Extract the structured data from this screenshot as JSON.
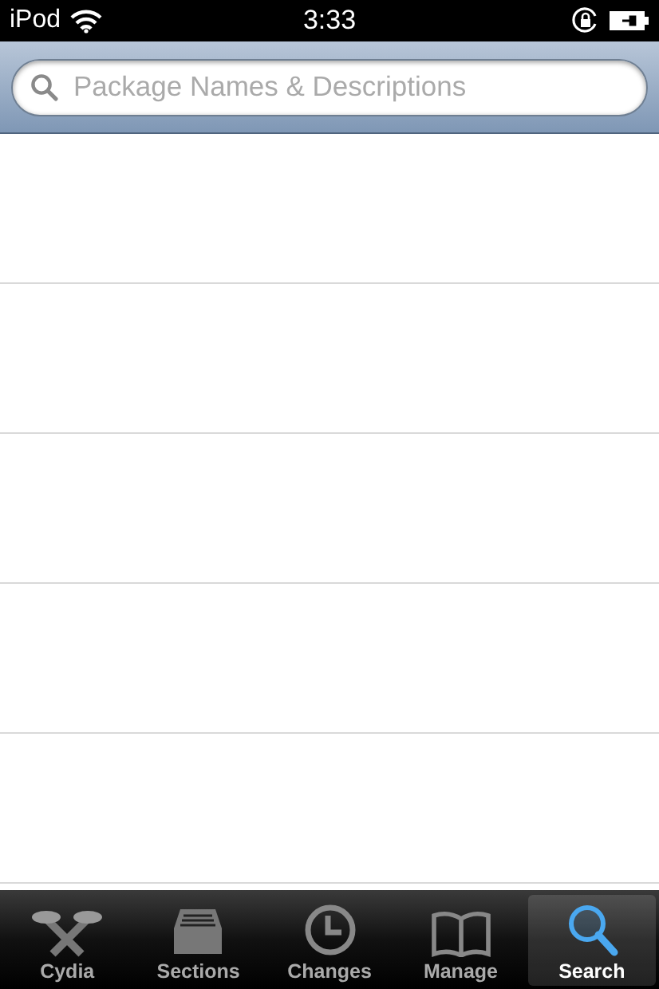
{
  "status_bar": {
    "carrier": "iPod",
    "time": "3:33"
  },
  "search": {
    "placeholder": "Package Names & Descriptions"
  },
  "tabs": [
    {
      "label": "Cydia",
      "selected": false
    },
    {
      "label": "Sections",
      "selected": false
    },
    {
      "label": "Changes",
      "selected": false
    },
    {
      "label": "Manage",
      "selected": false
    },
    {
      "label": "Search",
      "selected": true
    }
  ]
}
